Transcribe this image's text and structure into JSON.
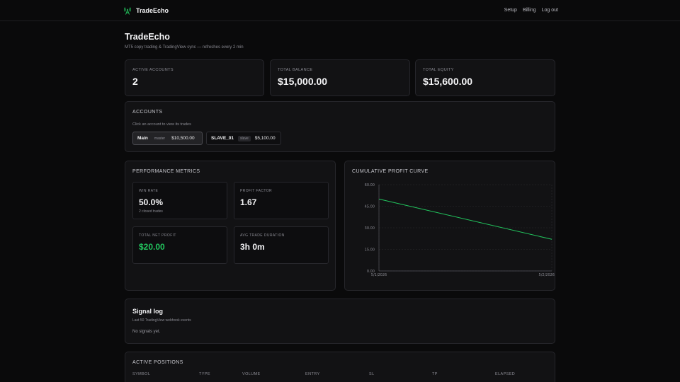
{
  "app": {
    "brand": "TradeEcho"
  },
  "nav": {
    "setup": "Setup",
    "billing": "Billing",
    "logout": "Log out"
  },
  "header": {
    "title": "TradeEcho",
    "subtitle": "MT5 copy trading & TradingView sync — refreshes every 2 min"
  },
  "stats": [
    {
      "label": "Active accounts",
      "value": "2"
    },
    {
      "label": "Total balance",
      "value": "$15,000.00"
    },
    {
      "label": "Total equity",
      "value": "$15,600.00"
    }
  ],
  "accounts": {
    "title": "Accounts",
    "hint": "Click an account to view its trades",
    "items": [
      {
        "name": "Main",
        "role": "master",
        "balance": "$10,500.00",
        "selected": true
      },
      {
        "name": "SLAVE_01",
        "role": "slave",
        "balance": "$5,100.00",
        "selected": false
      }
    ]
  },
  "performance": {
    "title": "Performance metrics",
    "metrics": [
      {
        "label": "Win rate",
        "value": "50.0%",
        "sub": "2 closed trades"
      },
      {
        "label": "Profit factor",
        "value": "1.67",
        "sub": ""
      },
      {
        "label": "Total net profit",
        "value": "$20.00",
        "sub": ""
      },
      {
        "label": "Avg trade duration",
        "value": "3h 0m",
        "sub": ""
      }
    ]
  },
  "chart": {
    "title": "Cumulative profit curve",
    "line_color": "#22c55e",
    "positive_color": "#22c55e"
  },
  "chart_data": {
    "type": "line",
    "title": "Cumulative profit curve",
    "x": [
      "5/1/2026",
      "5/2/2026"
    ],
    "series": [
      {
        "values": [
          50,
          22
        ]
      }
    ],
    "yticks": [
      "60.00",
      "45.00",
      "30.00",
      "15.00",
      "0.00"
    ],
    "ylim": [
      0,
      60
    ],
    "xlabel": "",
    "ylabel": "",
    "grid": true
  },
  "signal_log": {
    "title": "Signal log",
    "hint": "Last 50 TradingView webhook events",
    "empty": "No signals yet."
  },
  "positions": {
    "title": "Active positions",
    "columns": [
      "Symbol",
      "Type",
      "Volume",
      "Entry",
      "SL",
      "TP",
      "Elapsed"
    ]
  }
}
